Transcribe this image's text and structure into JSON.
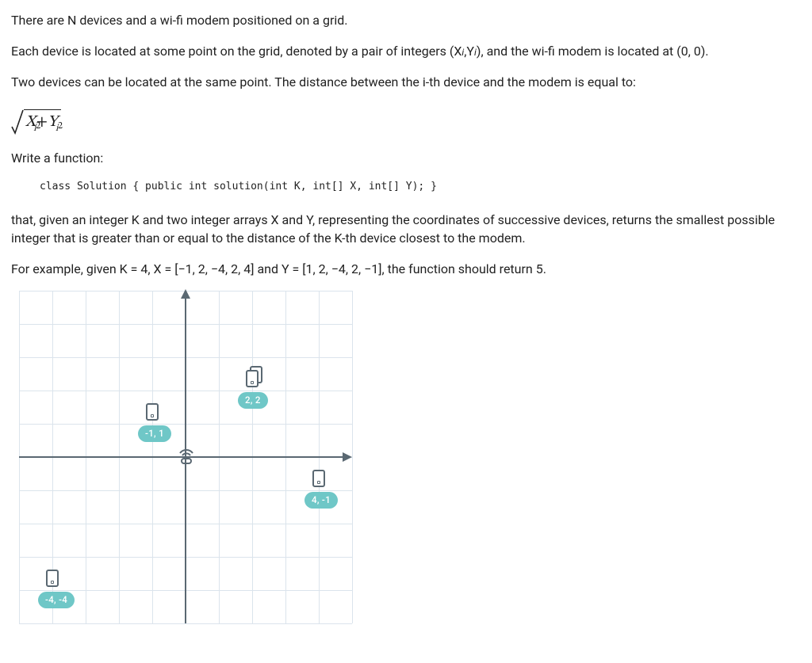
{
  "problem": {
    "p1": "There are N devices and a wi-fi modem positioned on a grid.",
    "p2_a": "Each device is located at some point on the grid, denoted by a pair of integers (X",
    "p2_b": ",Y",
    "p2_c": "), and the wi-fi modem is located at (0, 0).",
    "p3": "Two devices can be located at the same point. The distance between the i-th device and the modem is equal to:",
    "formula": {
      "var1": "X",
      "sub1": "i",
      "sup1": "2",
      "plus": " + ",
      "var2": "Y",
      "sub2": "i",
      "sup2": "2"
    },
    "write_fn": "Write a function:",
    "code": "class Solution { public int solution(int K, int[] X, int[] Y); }",
    "p4": "that, given an integer K and two integer arrays X and Y, representing the coordinates of successive devices, returns the smallest possible integer that is greater than or equal to the distance of the K-th device closest to the modem.",
    "p5": "For example, given K = 4, X = [−1, 2, −4, 2, 4] and Y = [1, 2, −4, 2, −1], the function should return 5."
  },
  "chart_data": {
    "type": "scatter",
    "title": "",
    "xlabel": "",
    "ylabel": "",
    "xlim": [
      -5,
      5
    ],
    "ylim": [
      -5,
      5
    ],
    "modem": {
      "x": 0,
      "y": 0
    },
    "points": [
      {
        "x": -1,
        "y": 1,
        "label": "-1, 1"
      },
      {
        "x": 2,
        "y": 2,
        "label": "2, 2",
        "count": 2
      },
      {
        "x": 4,
        "y": -1,
        "label": "4, -1"
      },
      {
        "x": -4,
        "y": -4,
        "label": "-4, -4"
      }
    ],
    "grid": true
  }
}
